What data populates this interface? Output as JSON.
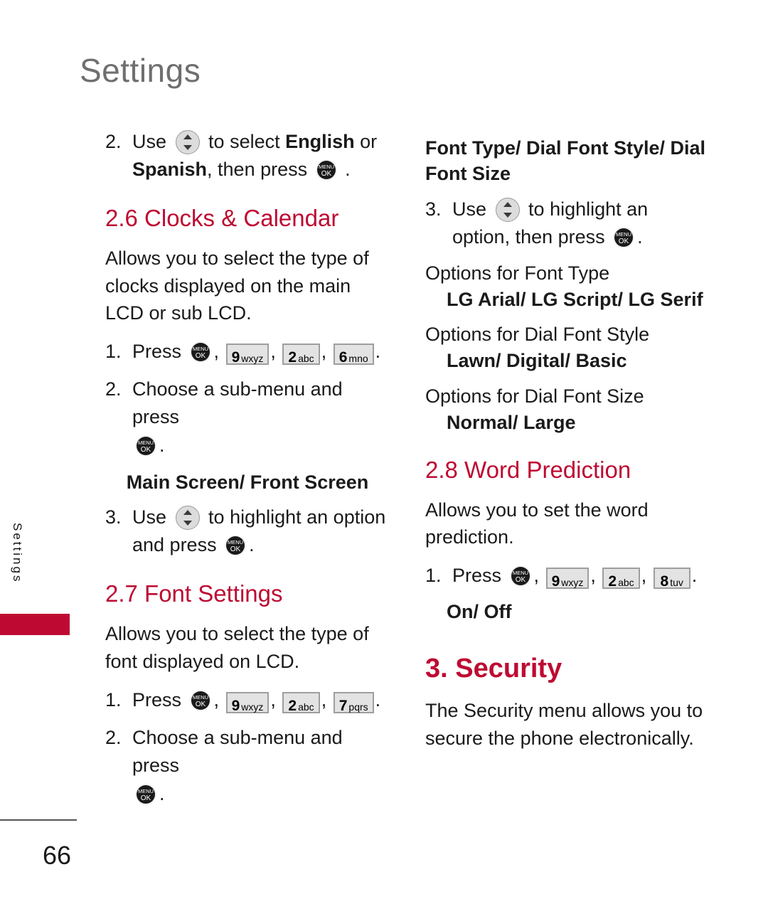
{
  "page": {
    "header_title": "Settings",
    "side_tab_label": "Settings",
    "page_number": "66",
    "accent_color": "#be0a32",
    "header_color": "#6f6f6f"
  },
  "icons": {
    "nav_key": "navigation-key-icon",
    "menu_ok_key": "menu-ok-key-icon",
    "menu_label_top": "MENU",
    "menu_label_bottom": "OK"
  },
  "keys": {
    "k9": {
      "digit": "9",
      "letters": "wxyz"
    },
    "k2": {
      "digit": "2",
      "letters": "abc"
    },
    "k6": {
      "digit": "6",
      "letters": "mno"
    },
    "k7": {
      "digit": "7",
      "letters": "pqrs"
    },
    "k8": {
      "digit": "8",
      "letters": "tuv"
    }
  },
  "left_column": {
    "lang_step": {
      "number": "2.",
      "part1": "Use",
      "part2": "to select",
      "bold1": "English",
      "part3": "or",
      "bold2": "Spanish",
      "part4": ", then press",
      "period": "."
    },
    "clocks_section": {
      "heading": "2.6 Clocks & Calendar",
      "description": "Allows you to select the type of clocks displayed on the main LCD or sub LCD.",
      "step1": {
        "number": "1.",
        "label": "Press",
        "comma": ",",
        "period": "."
      },
      "step2": {
        "number": "2.",
        "text": "Choose a sub-menu and press",
        "period": "."
      },
      "sub_heading": "Main Screen/ Front Screen",
      "step3": {
        "number": "3.",
        "part1": "Use",
        "part2": "to highlight an option and press",
        "period": "."
      }
    },
    "font_settings_section": {
      "heading": "2.7 Font Settings",
      "description": "Allows you to select the type of font displayed on LCD.",
      "step1": {
        "number": "1.",
        "label": "Press",
        "comma": ",",
        "period": "."
      },
      "step2": {
        "number": "2.",
        "text": "Choose a sub-menu and press",
        "period": "."
      }
    }
  },
  "right_column": {
    "font_options": {
      "sub_heading": "Font Type/ Dial Font Style/ Dial Font Size",
      "step3": {
        "number": "3.",
        "part1": "Use",
        "part2": "to highlight an option, then press",
        "period": "."
      },
      "groups": [
        {
          "label": "Options for Font Type",
          "value": "LG Arial/ LG Script/ LG Serif"
        },
        {
          "label": "Options for Dial Font Style",
          "value": "Lawn/ Digital/ Basic"
        },
        {
          "label": "Options for Dial Font Size",
          "value": "Normal/ Large"
        }
      ]
    },
    "word_prediction_section": {
      "heading": "2.8 Word Prediction",
      "description": "Allows you to set the word prediction.",
      "step1": {
        "number": "1.",
        "label": "Press",
        "comma": ",",
        "period": "."
      },
      "options_value": "On/ Off"
    },
    "security_section": {
      "heading": "3. Security",
      "description": "The Security menu allows you to secure the phone electronically."
    }
  }
}
